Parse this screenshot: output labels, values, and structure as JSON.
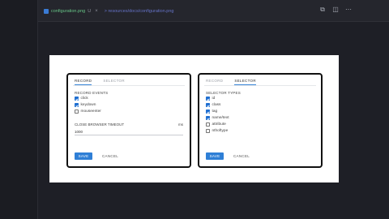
{
  "tab": {
    "filename": "configuration.png",
    "badge": "U",
    "close": "×",
    "path": "> resources/docs/configuration.png"
  },
  "toolbar": {
    "icons": [
      "git-compare-icon",
      "split-editor-icon",
      "more-actions-icon"
    ],
    "glyphs": [
      "⧉",
      "◫",
      "⋯"
    ]
  },
  "left_card": {
    "tabs": [
      "RECORD",
      "SELECTOR"
    ],
    "active_tab": "RECORD",
    "section": "RECORD EVENTS",
    "events": [
      {
        "label": "click",
        "checked": true
      },
      {
        "label": "keydown",
        "checked": true
      },
      {
        "label": "mouseenter",
        "checked": false
      }
    ],
    "timeout_label": "CLOSE BROWSER TIMEOUT",
    "timeout_unit": "ms",
    "timeout_value": "1000",
    "save": "SAVE",
    "cancel": "CANCEL"
  },
  "right_card": {
    "tabs": [
      "RECORD",
      "SELECTOR"
    ],
    "active_tab": "SELECTOR",
    "section": "SELECTOR TYPES",
    "types": [
      {
        "label": "id",
        "checked": true
      },
      {
        "label": "class",
        "checked": true
      },
      {
        "label": "tag",
        "checked": true
      },
      {
        "label": "name/text",
        "checked": true
      },
      {
        "label": "attribute",
        "checked": false
      },
      {
        "label": "nthoftype",
        "checked": false
      }
    ],
    "save": "SAVE",
    "cancel": "CANCEL"
  },
  "colors": {
    "accent": "#2f7fd6",
    "background": "#1e1f26",
    "filename": "#67c587"
  }
}
